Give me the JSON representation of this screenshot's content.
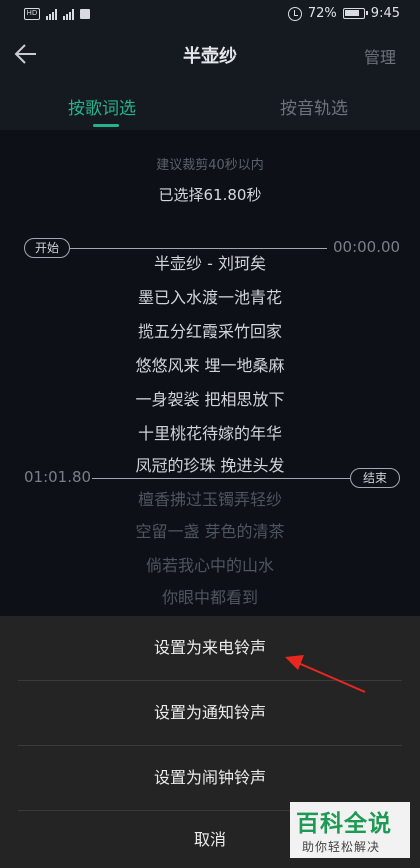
{
  "status_bar": {
    "battery": "72%",
    "time": "9:45",
    "network": "4G"
  },
  "header": {
    "title": "半壶纱",
    "manage_label": "管理"
  },
  "tabs": [
    {
      "label": "按歌词选",
      "active": true
    },
    {
      "label": "按音轨选",
      "active": false
    }
  ],
  "selection": {
    "hint": "建议裁剪40秒以内",
    "selected": "已选择61.80秒",
    "start_label": "开始",
    "start_time": "00:00.00",
    "end_label": "结束",
    "end_time": "01:01.80"
  },
  "lyrics": [
    {
      "text": "半壶纱 - 刘珂矣",
      "in_range": true
    },
    {
      "text": "墨已入水渡一池青花",
      "in_range": true
    },
    {
      "text": "揽五分红霞采竹回家",
      "in_range": true
    },
    {
      "text": "悠悠风来 埋一地桑麻",
      "in_range": true
    },
    {
      "text": "一身袈裟  把相思放下",
      "in_range": true
    },
    {
      "text": "十里桃花待嫁的年华",
      "in_range": true
    },
    {
      "text": "凤冠的珍珠 挽进头发",
      "in_range": true
    },
    {
      "text": "檀香拂过玉镯弄轻纱",
      "in_range": false
    },
    {
      "text": "空留一盏 芽色的清茶",
      "in_range": false
    },
    {
      "text": "倘若我心中的山水",
      "in_range": false
    },
    {
      "text": "你眼中都看到",
      "in_range": false
    }
  ],
  "sheet": {
    "options": [
      "设置为来电铃声",
      "设置为通知铃声",
      "设置为闹钟铃声"
    ],
    "cancel": "取消"
  },
  "watermark": {
    "title": "百科全说",
    "subtitle": "助你轻松解决"
  },
  "colors": {
    "accent": "#27b38a",
    "background": "#0d1117",
    "sheet": "#242424",
    "arrow": "#e8281f"
  }
}
